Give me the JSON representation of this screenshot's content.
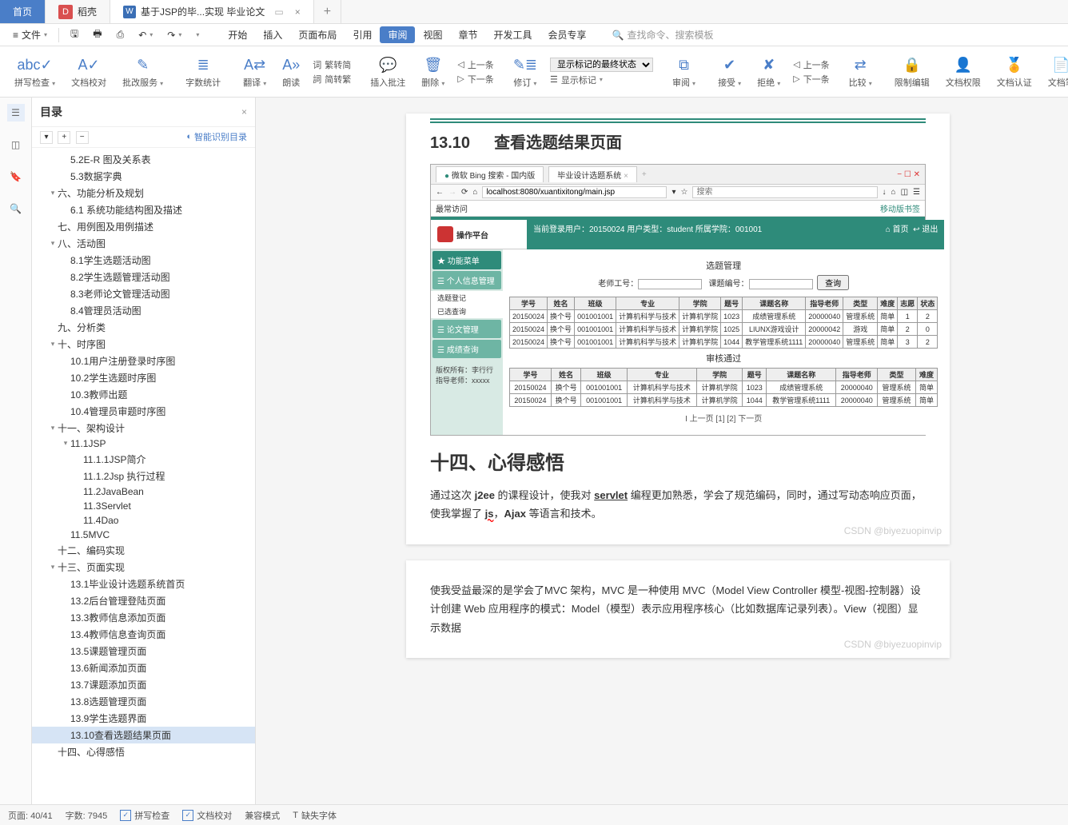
{
  "tabs": {
    "home": "首页",
    "daoke": "稻壳",
    "doc": "基于JSP的毕...实现 毕业论文"
  },
  "menu": {
    "file": "文件",
    "ribbon_tabs": [
      "开始",
      "插入",
      "页面布局",
      "引用",
      "审阅",
      "视图",
      "章节",
      "开发工具",
      "会员专享"
    ],
    "active_tab": "审阅",
    "search_placeholder": "查找命令、搜索模板"
  },
  "ribbon": {
    "spellcheck": "拼写检查",
    "proofing": "文档校对",
    "changes": "批改服务",
    "wordcount": "字数统计",
    "translate": "翻译",
    "read": "朗读",
    "convert1": "繁转简",
    "convert2": "简转繁",
    "insert_comment": "插入批注",
    "delete": "删除",
    "prev": "上一条",
    "next": "下一条",
    "revise": "修订",
    "show_markup_label": "显示标记的最终状态",
    "show_markup": "显示标记",
    "review": "审阅",
    "accept": "接受",
    "reject": "拒绝",
    "rprev": "上一条",
    "rnext": "下一条",
    "compare": "比较",
    "restrict": "限制编辑",
    "permission": "文档权限",
    "certify": "文档认证",
    "docnote": "文档笔"
  },
  "outline": {
    "title": "目录",
    "smart": "智能识别目录",
    "items": [
      {
        "level": 3,
        "text": "5.2E-R 图及关系表"
      },
      {
        "level": 3,
        "text": "5.3数据字典"
      },
      {
        "level": 2,
        "text": "六、功能分析及规划",
        "arrow": "v"
      },
      {
        "level": 3,
        "text": "6.1 系统功能结构图及描述"
      },
      {
        "level": 2,
        "text": "七、用例图及用例描述"
      },
      {
        "level": 2,
        "text": "八、活动图",
        "arrow": "v"
      },
      {
        "level": 3,
        "text": "8.1学生选题活动图"
      },
      {
        "level": 3,
        "text": "8.2学生选题管理活动图"
      },
      {
        "level": 3,
        "text": "8.3老师论文管理活动图"
      },
      {
        "level": 3,
        "text": "8.4管理员活动图"
      },
      {
        "level": 2,
        "text": "九、分析类"
      },
      {
        "level": 2,
        "text": "十、时序图",
        "arrow": "v"
      },
      {
        "level": 3,
        "text": "10.1用户注册登录时序图"
      },
      {
        "level": 3,
        "text": "10.2学生选题时序图"
      },
      {
        "level": 3,
        "text": "10.3教师出题"
      },
      {
        "level": 3,
        "text": "10.4管理员审题时序图"
      },
      {
        "level": 2,
        "text": "十一、架构设计",
        "arrow": "v"
      },
      {
        "level": 3,
        "text": "11.1JSP",
        "arrow": "v"
      },
      {
        "level": 4,
        "text": "11.1.1JSP简介"
      },
      {
        "level": 4,
        "text": "11.1.2Jsp 执行过程"
      },
      {
        "level": 4,
        "text": "11.2JavaBean"
      },
      {
        "level": 4,
        "text": "11.3Servlet"
      },
      {
        "level": 4,
        "text": "11.4Dao"
      },
      {
        "level": 3,
        "text": "11.5MVC"
      },
      {
        "level": 2,
        "text": "十二、编码实现"
      },
      {
        "level": 2,
        "text": "十三、页面实现",
        "arrow": "v"
      },
      {
        "level": 3,
        "text": "13.1毕业设计选题系统首页"
      },
      {
        "level": 3,
        "text": "13.2后台管理登陆页面"
      },
      {
        "level": 3,
        "text": "13.3教师信息添加页面"
      },
      {
        "level": 3,
        "text": "13.4教师信息查询页面"
      },
      {
        "level": 3,
        "text": "13.5课题管理页面"
      },
      {
        "level": 3,
        "text": "13.6新闻添加页面"
      },
      {
        "level": 3,
        "text": "13.7课题添加页面"
      },
      {
        "level": 3,
        "text": "13.8选题管理页面"
      },
      {
        "level": 3,
        "text": "13.9学生选题界面"
      },
      {
        "level": 3,
        "text": "13.10查看选题结果页面",
        "active": true
      },
      {
        "level": 2,
        "text": "十四、心得感悟"
      }
    ]
  },
  "doc": {
    "section_num": "13.10",
    "section_title": "查看选题结果页面",
    "chapter": "十四、心得感悟",
    "para1_a": "通过这次 ",
    "para1_b": "j2ee",
    "para1_c": " 的课程设计，使我对 ",
    "para1_d": "servlet",
    "para1_e": " 编程更加熟悉，学会了规范编码，同时，通过写动态响应页面，使我掌握了 ",
    "para1_f": "js",
    "para1_g": "，",
    "para1_h": "Ajax",
    "para1_i": " 等语言和技术。",
    "para2": "使我受益最深的是学会了MVC 架构，MVC 是一种使用 MVC（Model View Controller 模型-视图-控制器）设计创建 Web 应用程序的模式：Model（模型）表示应用程序核心（比如数据库记录列表）。View（视图）显示数据",
    "watermark": "CSDN @biyezuopinvip"
  },
  "browser": {
    "tab1": "微软 Bing 搜索 - 国内版",
    "tab2": "毕业设计选题系统",
    "url": "localhost:8080/xuantixitong/main.jsp",
    "search_hint": "搜索",
    "fav": "最常访问",
    "mobile": "移动版书签"
  },
  "app": {
    "logo": "操作平台",
    "login_info": "当前登录用户：20150024   用户类型：student   所属学院：001001",
    "nav_home": "首页",
    "nav_exit": "退出",
    "menu_title": "功能菜单",
    "menu1": "个人信息管理",
    "menu2": "选题登记",
    "menu3": "已选查询",
    "menu4": "论文管理",
    "menu5": "成绩查询",
    "meta1": "版权所有：李行行",
    "meta2": "指导老师：xxxxx",
    "content_title": "选题管理",
    "filter_label1": "老师工号：",
    "filter_label2": "课题编号：",
    "filter_btn": "查询",
    "table1_headers": [
      "学号",
      "姓名",
      "班级",
      "专业",
      "学院",
      "题号",
      "课题名称",
      "指导老师",
      "类型",
      "难度",
      "志愿",
      "状态"
    ],
    "table1_rows": [
      [
        "20150024",
        "换个号",
        "001001001",
        "计算机科学与技术",
        "计算机学院",
        "1023",
        "成绩管理系统",
        "20000040",
        "管理系统",
        "简单",
        "1",
        "2"
      ],
      [
        "20150024",
        "换个号",
        "001001001",
        "计算机科学与技术",
        "计算机学院",
        "1025",
        "LIUNX游戏设计",
        "20000042",
        "游戏",
        "简单",
        "2",
        "0"
      ],
      [
        "20150024",
        "换个号",
        "001001001",
        "计算机科学与技术",
        "计算机学院",
        "1044",
        "教学管理系统1111",
        "20000040",
        "管理系统",
        "简单",
        "3",
        "2"
      ]
    ],
    "midtext": "审核通过",
    "table2_headers": [
      "学号",
      "姓名",
      "班级",
      "专业",
      "学院",
      "题号",
      "课题名称",
      "指导老师",
      "类型",
      "难度"
    ],
    "table2_rows": [
      [
        "20150024",
        "换个号",
        "001001001",
        "计算机科学与技术",
        "计算机学院",
        "1023",
        "成绩管理系统",
        "20000040",
        "管理系统",
        "简单"
      ],
      [
        "20150024",
        "换个号",
        "001001001",
        "计算机科学与技术",
        "计算机学院",
        "1044",
        "教学管理系统1111",
        "20000040",
        "管理系统",
        "简单"
      ]
    ],
    "pager": "I 上一页  [1]  [2]  下一页"
  },
  "status": {
    "page": "页面: 40/41",
    "words": "字数: 7945",
    "spell": "拼写检查",
    "proof": "文档校对",
    "compat": "兼容模式",
    "missing_font": "缺失字体"
  }
}
